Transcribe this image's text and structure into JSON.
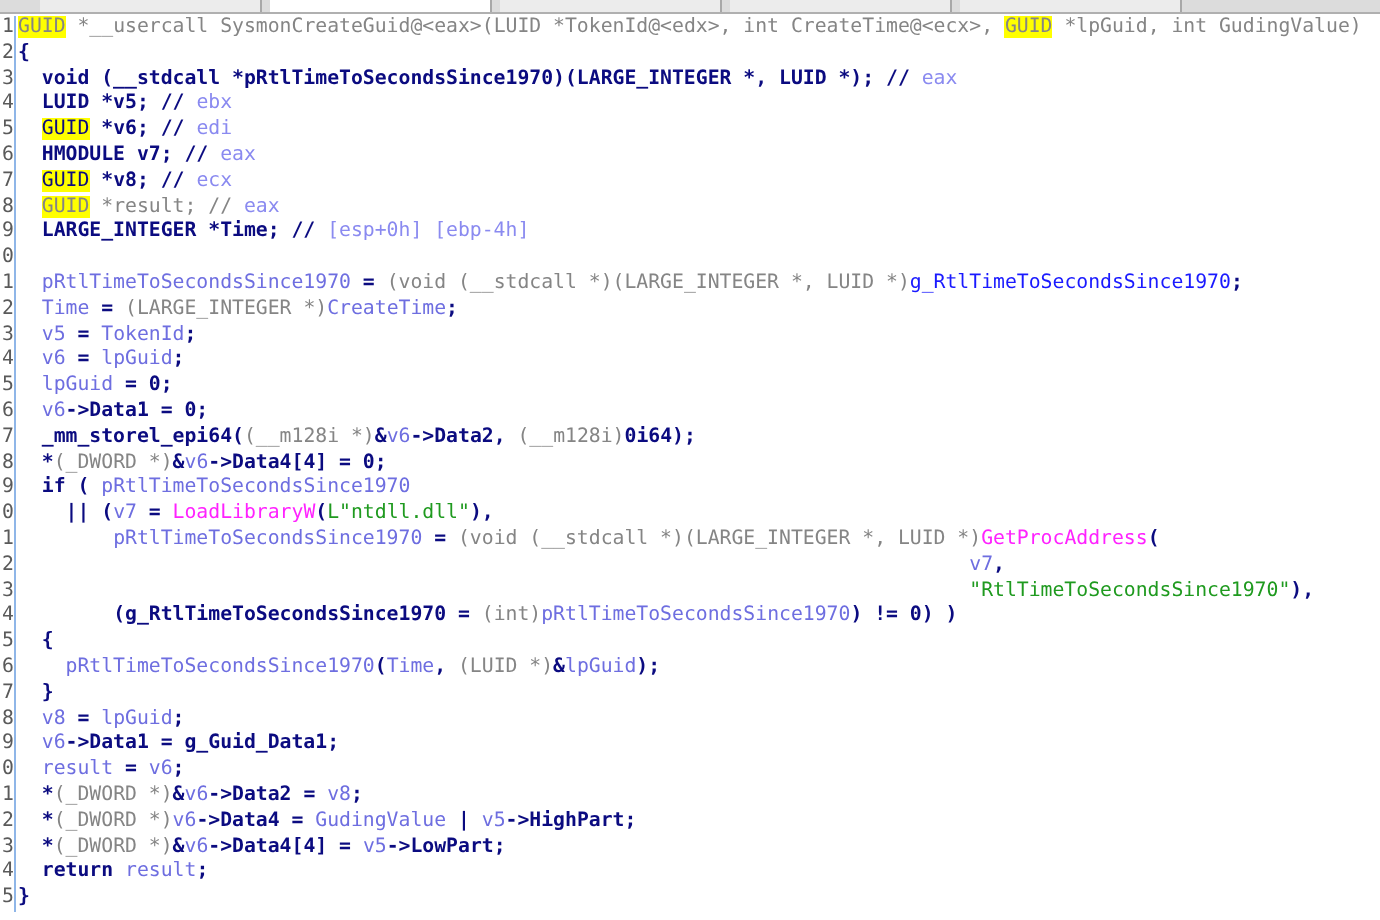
{
  "lines": [
    {
      "number": "1",
      "segments": [
        {
          "text": "GUID",
          "kind": "marked_type"
        },
        {
          "text": " *__usercall SysmonCreateGuid@<eax>(LUID *TokenId@<edx>, int CreateTime@<ecx>, ",
          "kind": "type"
        },
        {
          "text": "GUID",
          "kind": "marked_type"
        },
        {
          "text": " *lpGuid, int GudingValue)",
          "kind": "type"
        }
      ]
    },
    {
      "number": "2",
      "segments": [
        {
          "text": "{",
          "kind": "plain"
        }
      ]
    },
    {
      "number": "3",
      "segments": [
        {
          "text": "  void (__stdcall *pRtlTimeToSecondsSince1970)(LARGE_INTEGER *, LUID *); // ",
          "kind": "plain"
        },
        {
          "text": "eax",
          "kind": "reg"
        }
      ]
    },
    {
      "number": "4",
      "segments": [
        {
          "text": "  LUID *v5; // ",
          "kind": "plain"
        },
        {
          "text": "ebx",
          "kind": "reg"
        }
      ]
    },
    {
      "number": "5",
      "segments": [
        {
          "text": "  GUID",
          "kind": "marked"
        },
        {
          "text": " *v6; // ",
          "kind": "plain"
        },
        {
          "text": "edi",
          "kind": "reg"
        }
      ]
    },
    {
      "number": "6",
      "segments": [
        {
          "text": "  HMODULE v7; // ",
          "kind": "plain"
        },
        {
          "text": "eax",
          "kind": "reg"
        }
      ]
    },
    {
      "number": "7",
      "segments": [
        {
          "text": "  GUID",
          "kind": "marked"
        },
        {
          "text": " *v8; // ",
          "kind": "plain"
        },
        {
          "text": "ecx",
          "kind": "reg"
        }
      ]
    },
    {
      "number": "8",
      "segments": [
        {
          "text": "  GUID",
          "kind": "marked_type"
        },
        {
          "text": " *result; // ",
          "kind": "type"
        },
        {
          "text": "eax",
          "kind": "reg"
        }
      ]
    },
    {
      "number": "9",
      "segments": [
        {
          "text": "  LARGE_INTEGER *Time; // ",
          "kind": "plain"
        },
        {
          "text": "[esp+0h] [ebp-4h]",
          "kind": "reg"
        }
      ]
    },
    {
      "number": "0"
    },
    {
      "number": "1",
      "segments": [
        {
          "text": "  pRtlTimeToSecondsSince1970",
          "kind": "local"
        },
        {
          "text": " = ",
          "kind": "plain"
        },
        {
          "text": "(void (__stdcall *)(LARGE_INTEGER *, LUID *)",
          "kind": "type"
        },
        {
          "text": "g_RtlTimeToSecondsSince1970",
          "kind": "global"
        },
        {
          "text": ";",
          "kind": "plain"
        }
      ]
    },
    {
      "number": "2",
      "segments": [
        {
          "text": "  Time",
          "kind": "local"
        },
        {
          "text": " = ",
          "kind": "plain"
        },
        {
          "text": "(LARGE_INTEGER *)",
          "kind": "type"
        },
        {
          "text": "CreateTime",
          "kind": "local"
        },
        {
          "text": ";",
          "kind": "plain"
        }
      ]
    },
    {
      "number": "3",
      "segments": [
        {
          "text": "  v5",
          "kind": "local"
        },
        {
          "text": " = ",
          "kind": "plain"
        },
        {
          "text": "TokenId",
          "kind": "local"
        },
        {
          "text": ";",
          "kind": "plain"
        }
      ]
    },
    {
      "number": "4",
      "segments": [
        {
          "text": "  v6",
          "kind": "local"
        },
        {
          "text": " = ",
          "kind": "plain"
        },
        {
          "text": "lpGuid",
          "kind": "local"
        },
        {
          "text": ";",
          "kind": "plain"
        }
      ]
    },
    {
      "number": "5",
      "segments": [
        {
          "text": "  lpGuid",
          "kind": "local"
        },
        {
          "text": " = 0;",
          "kind": "plain"
        }
      ]
    },
    {
      "number": "6",
      "segments": [
        {
          "text": "  v6",
          "kind": "local"
        },
        {
          "text": "->Data1 = 0;",
          "kind": "plain"
        }
      ]
    },
    {
      "number": "7",
      "segments": [
        {
          "text": "  _mm_storel_epi64(",
          "kind": "plain"
        },
        {
          "text": "(__m128i *)",
          "kind": "type"
        },
        {
          "text": "&",
          "kind": "plain"
        },
        {
          "text": "v6",
          "kind": "local"
        },
        {
          "text": "->Data2, ",
          "kind": "plain"
        },
        {
          "text": "(__m128i)",
          "kind": "type"
        },
        {
          "text": "0i64);",
          "kind": "plain"
        }
      ]
    },
    {
      "number": "8",
      "segments": [
        {
          "text": "  *",
          "kind": "plain"
        },
        {
          "text": "(_DWORD *)",
          "kind": "type"
        },
        {
          "text": "&",
          "kind": "plain"
        },
        {
          "text": "v6",
          "kind": "local"
        },
        {
          "text": "->Data4[4] = 0;",
          "kind": "plain"
        }
      ]
    },
    {
      "number": "9",
      "segments": [
        {
          "text": "  if ( ",
          "kind": "plain"
        },
        {
          "text": "pRtlTimeToSecondsSince1970",
          "kind": "local"
        }
      ]
    },
    {
      "number": "0",
      "segments": [
        {
          "text": "    || (",
          "kind": "plain"
        },
        {
          "text": "v7",
          "kind": "local"
        },
        {
          "text": " = ",
          "kind": "plain"
        },
        {
          "text": "LoadLibraryW",
          "kind": "import"
        },
        {
          "text": "(",
          "kind": "plain"
        },
        {
          "text": "L\"ntdll.dll\"",
          "kind": "string"
        },
        {
          "text": "),",
          "kind": "plain"
        }
      ]
    },
    {
      "number": "1",
      "segments": [
        {
          "text": "        pRtlTimeToSecondsSince1970",
          "kind": "local"
        },
        {
          "text": " = ",
          "kind": "plain"
        },
        {
          "text": "(void (__stdcall *)(LARGE_INTEGER *, LUID *)",
          "kind": "type"
        },
        {
          "text": "GetProcAddress",
          "kind": "import"
        },
        {
          "text": "(",
          "kind": "plain"
        }
      ]
    },
    {
      "number": "2",
      "segments": [
        {
          "text": "                                                                                v7",
          "kind": "local"
        },
        {
          "text": ",",
          "kind": "plain"
        }
      ]
    },
    {
      "number": "3",
      "segments": [
        {
          "text": "                                                                                \"RtlTimeToSecondsSince1970\"",
          "kind": "string"
        },
        {
          "text": "),",
          "kind": "plain"
        }
      ]
    },
    {
      "number": "4",
      "segments": [
        {
          "text": "        (g_RtlTimeToSecondsSince1970 = ",
          "kind": "plain"
        },
        {
          "text": "(int)",
          "kind": "type"
        },
        {
          "text": "pRtlTimeToSecondsSince1970",
          "kind": "local"
        },
        {
          "text": ") != 0) )",
          "kind": "plain"
        }
      ]
    },
    {
      "number": "5",
      "segments": [
        {
          "text": "  {",
          "kind": "plain"
        }
      ]
    },
    {
      "number": "6",
      "segments": [
        {
          "text": "    pRtlTimeToSecondsSince1970",
          "kind": "local"
        },
        {
          "text": "(",
          "kind": "plain"
        },
        {
          "text": "Time",
          "kind": "local"
        },
        {
          "text": ", ",
          "kind": "plain"
        },
        {
          "text": "(LUID *)",
          "kind": "type"
        },
        {
          "text": "&",
          "kind": "plain"
        },
        {
          "text": "lpGuid",
          "kind": "local"
        },
        {
          "text": ");",
          "kind": "plain"
        }
      ]
    },
    {
      "number": "7",
      "segments": [
        {
          "text": "  }",
          "kind": "plain"
        }
      ]
    },
    {
      "number": "8",
      "segments": [
        {
          "text": "  v8",
          "kind": "local"
        },
        {
          "text": " = ",
          "kind": "plain"
        },
        {
          "text": "lpGuid",
          "kind": "local"
        },
        {
          "text": ";",
          "kind": "plain"
        }
      ]
    },
    {
      "number": "9",
      "segments": [
        {
          "text": "  v6",
          "kind": "local"
        },
        {
          "text": "->Data1 = g_Guid_Data1;",
          "kind": "plain"
        }
      ]
    },
    {
      "number": "0",
      "segments": [
        {
          "text": "  result",
          "kind": "local"
        },
        {
          "text": " = ",
          "kind": "plain"
        },
        {
          "text": "v6",
          "kind": "local"
        },
        {
          "text": ";",
          "kind": "plain"
        }
      ]
    },
    {
      "number": "1",
      "segments": [
        {
          "text": "  *",
          "kind": "plain"
        },
        {
          "text": "(_DWORD *)",
          "kind": "type"
        },
        {
          "text": "&",
          "kind": "plain"
        },
        {
          "text": "v6",
          "kind": "local"
        },
        {
          "text": "->Data2 = ",
          "kind": "plain"
        },
        {
          "text": "v8",
          "kind": "local"
        },
        {
          "text": ";",
          "kind": "plain"
        }
      ]
    },
    {
      "number": "2",
      "segments": [
        {
          "text": "  *",
          "kind": "plain"
        },
        {
          "text": "(_DWORD *)",
          "kind": "type"
        },
        {
          "text": "v6",
          "kind": "local"
        },
        {
          "text": "->Data4 = ",
          "kind": "plain"
        },
        {
          "text": "GudingValue",
          "kind": "local"
        },
        {
          "text": " | ",
          "kind": "plain"
        },
        {
          "text": "v5",
          "kind": "local"
        },
        {
          "text": "->HighPart;",
          "kind": "plain"
        }
      ]
    },
    {
      "number": "3",
      "segments": [
        {
          "text": "  *",
          "kind": "plain"
        },
        {
          "text": "(_DWORD *)",
          "kind": "type"
        },
        {
          "text": "&",
          "kind": "plain"
        },
        {
          "text": "v6",
          "kind": "local"
        },
        {
          "text": "->Data4[4] = ",
          "kind": "plain"
        },
        {
          "text": "v5",
          "kind": "local"
        },
        {
          "text": "->LowPart;",
          "kind": "plain"
        }
      ]
    },
    {
      "number": "4",
      "segments": [
        {
          "text": "  return ",
          "kind": "plain"
        },
        {
          "text": "result",
          "kind": "local"
        },
        {
          "text": ";",
          "kind": "plain"
        }
      ]
    },
    {
      "number": "5",
      "segments": [
        {
          "text": "}",
          "kind": "plain"
        }
      ]
    }
  ]
}
